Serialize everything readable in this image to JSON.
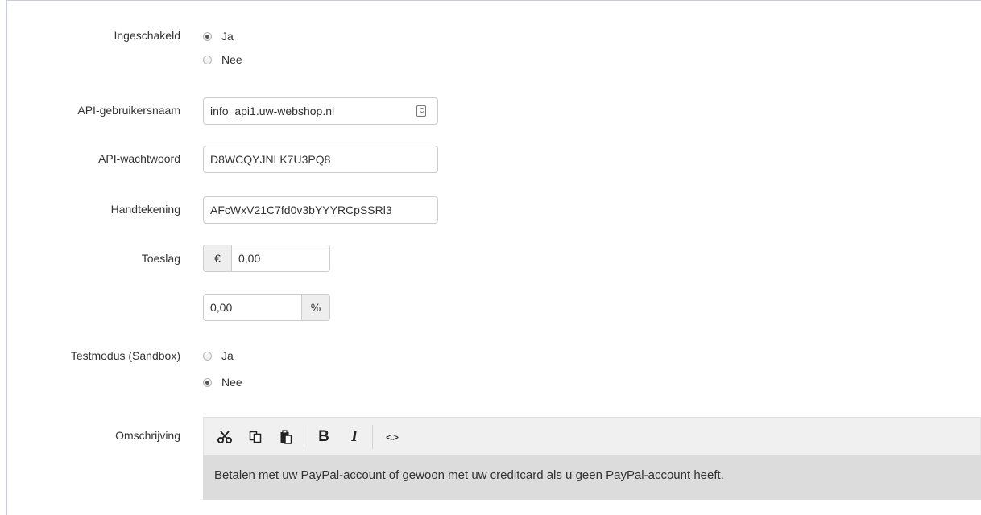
{
  "enabled": {
    "label": "Ingeschakeld",
    "options": [
      "Ja",
      "Nee"
    ],
    "selected": "Ja"
  },
  "api_username": {
    "label": "API-gebruikersnaam",
    "value": "info_api1.uw-webshop.nl",
    "icon": "contact-card-icon"
  },
  "api_password": {
    "label": "API-wachtwoord",
    "value": "D8WCQYJNLK7U3PQ8"
  },
  "signature": {
    "label": "Handtekening",
    "value": "AFcWxV21C7fd0v3bYYYRCpSSRl3"
  },
  "surcharge": {
    "label": "Toeslag",
    "currency_symbol": "€",
    "fixed_value": "0,00",
    "percent_value": "0,00",
    "percent_symbol": "%"
  },
  "test_mode": {
    "label": "Testmodus (Sandbox)",
    "options": [
      "Ja",
      "Nee"
    ],
    "selected": "Nee"
  },
  "description": {
    "label": "Omschrijving",
    "toolbar": {
      "cut": "cut-icon",
      "copy": "copy-icon",
      "paste": "paste-icon",
      "bold": "B",
      "italic": "I",
      "source": "<>"
    },
    "text": "Betalen met uw PayPal-account of gewoon met uw creditcard als u geen PayPal-account heeft."
  }
}
